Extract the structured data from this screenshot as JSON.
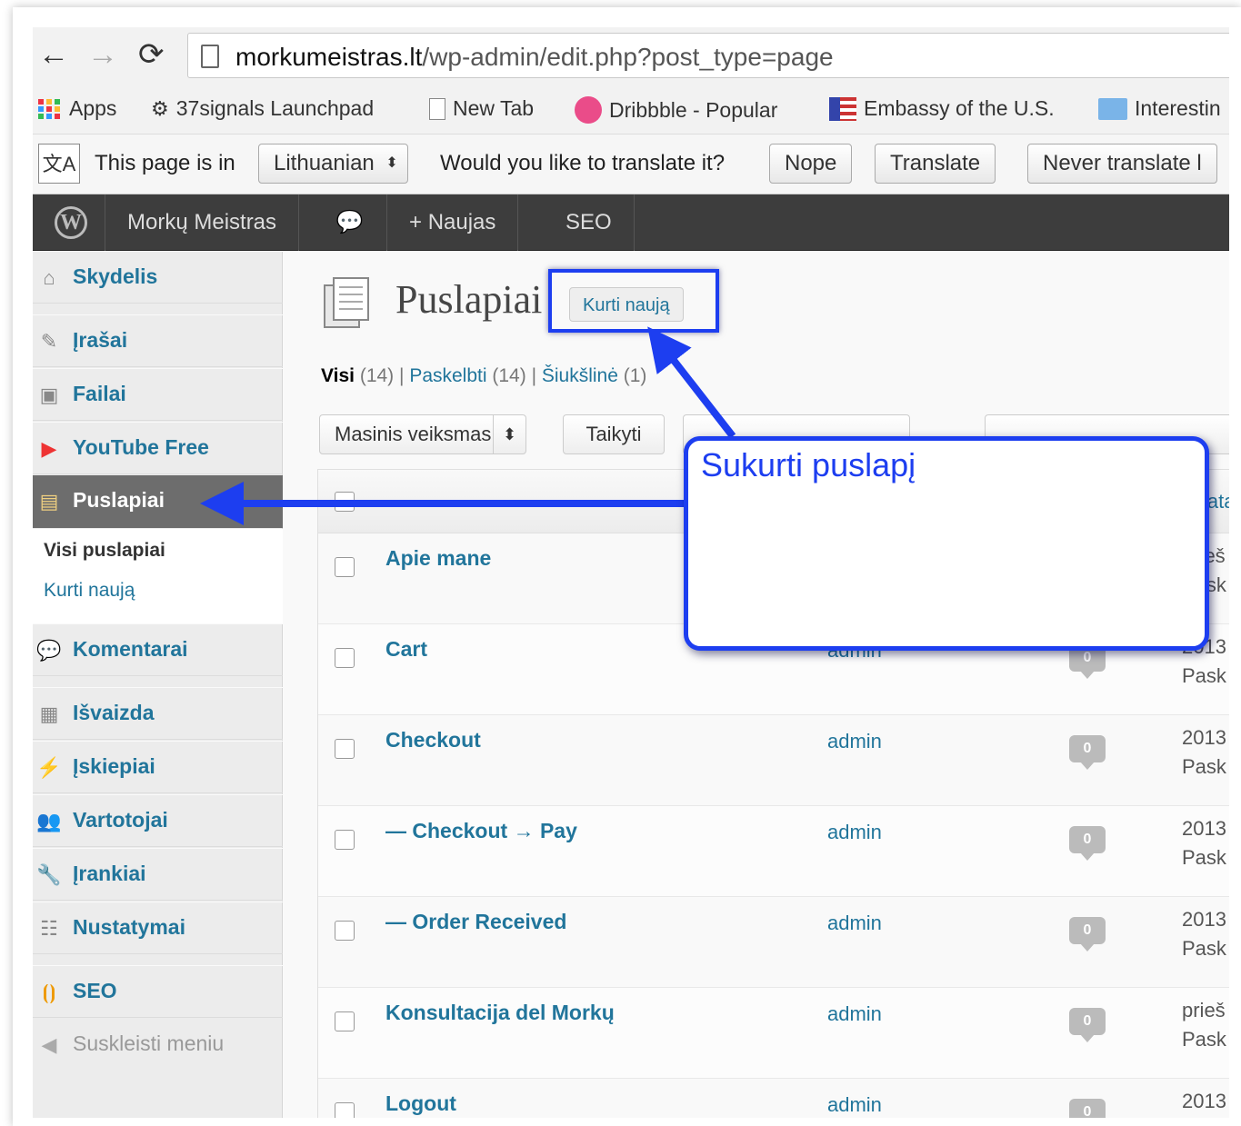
{
  "browser": {
    "url_prefix": "morkumeistras.lt",
    "url_rest": "/wp-admin/edit.php?post_type=page",
    "bookmarks": [
      "Apps",
      "37signals Launchpad",
      "New Tab",
      "Dribbble - Popular",
      "Embassy of the U.S.",
      "Interestin"
    ],
    "translate_bar": {
      "prefix": "This page is in",
      "language": "Lithuanian",
      "question": "Would you like to translate it?",
      "nope": "Nope",
      "translate": "Translate",
      "never": "Never translate l"
    }
  },
  "adminbar": {
    "site": "Morkų Meistras",
    "new": "Naujas",
    "seo": "SEO"
  },
  "sidebar": {
    "items": [
      {
        "label": "Skydelis"
      },
      {
        "label": "Įrašai"
      },
      {
        "label": "Failai"
      },
      {
        "label": "YouTube Free"
      },
      {
        "label": "Puslapiai"
      },
      {
        "label": "Komentarai"
      },
      {
        "label": "Išvaizda"
      },
      {
        "label": "Įskiepiai"
      },
      {
        "label": "Vartotojai"
      },
      {
        "label": "Įrankiai"
      },
      {
        "label": "Nustatymai"
      },
      {
        "label": "SEO"
      },
      {
        "label": "Suskleisti meniu"
      }
    ],
    "submenu": {
      "all": "Visi puslapiai",
      "add": "Kurti naują"
    }
  },
  "main": {
    "title": "Puslapiai",
    "add_new": "Kurti naują",
    "filters": {
      "all": "Visi",
      "all_count": "(14)",
      "published": "Paskelbti",
      "published_count": "(14)",
      "trash": "Šiukšlinė",
      "trash_count": "(1)"
    },
    "bulk": "Masinis veiksmas",
    "apply": "Taikyti",
    "date_header": "Data",
    "rows": [
      {
        "title": "Apie mane",
        "author": "",
        "comments": "",
        "date1": "prieš",
        "date2": "Pask"
      },
      {
        "title": "Cart",
        "author": "admin",
        "comments": "0",
        "date1": "2013",
        "date2": "Pask"
      },
      {
        "title": "Checkout",
        "author": "admin",
        "comments": "0",
        "date1": "2013",
        "date2": "Pask"
      },
      {
        "title": "— Checkout → Pay",
        "author": "admin",
        "comments": "0",
        "date1": "2013",
        "date2": "Pask"
      },
      {
        "title": "— Order Received",
        "author": "admin",
        "comments": "0",
        "date1": "2013",
        "date2": "Pask"
      },
      {
        "title": "Konsultacija del Morkų",
        "author": "admin",
        "comments": "0",
        "date1": "prieš",
        "date2": "Pask"
      },
      {
        "title": "Logout",
        "author": "admin",
        "comments": "0",
        "date1": "2013",
        "date2": ""
      }
    ]
  },
  "callout": {
    "text": "Sukurti puslapį"
  },
  "colors": {
    "accent": "#1d3ef0",
    "link": "#21759b",
    "adminbar": "#3d3d3d"
  }
}
